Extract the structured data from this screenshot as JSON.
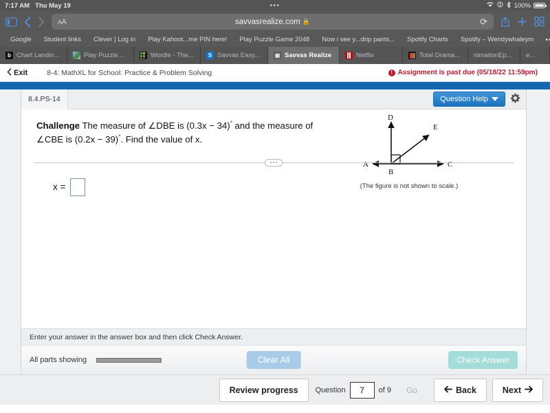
{
  "status_bar": {
    "time": "7:17 AM",
    "date": "Thu May 19",
    "center_dots": "•••",
    "wifi_icon": "wifi-icon",
    "location_icon": "location-icon",
    "bluetooth_icon": "bluetooth-icon",
    "battery_percent": "100%"
  },
  "browser": {
    "sidebar_icon": "sidebar-icon",
    "back_icon": "chevron-left-icon",
    "forward_icon": "chevron-right-icon",
    "text_size_label": "AA",
    "url": "savvasrealize.com",
    "lock_icon": "lock-icon",
    "reload_icon": "reload-icon",
    "share_icon": "share-icon",
    "new_tab_icon": "plus-icon",
    "tabs_overview_icon": "tabs-grid-icon",
    "bookmarks": [
      "Google",
      "Student links",
      "Clever | Log in",
      "Play Kahoot...me PIN here!",
      "Play Puzzle Game 2048",
      "Now i see y...drip pants...",
      "Spotify Charts",
      "Spotify – Wendywhaleym"
    ],
    "bookmarks_more": "•••",
    "tabs": [
      {
        "title": "Chart Landin...",
        "favicon": "b-logo-icon",
        "active": false
      },
      {
        "title": "Play Puzzle...",
        "favicon": "puzzle-icon",
        "active": false
      },
      {
        "title": "Wordle - The...",
        "favicon": "wordle-grid-icon",
        "active": false
      },
      {
        "title": "Savvas Easy...",
        "favicon": "savvas-s-icon",
        "active": false
      },
      {
        "title": "Savvas Realize",
        "favicon": "savvas-realize-icon",
        "active": true
      },
      {
        "title": "Netflix",
        "favicon": "netflix-icon",
        "active": false
      },
      {
        "title": "Total Drama...",
        "favicon": "total-drama-icon",
        "active": false
      },
      {
        "title": "nimationEp...",
        "favicon": "none",
        "active": false
      },
      {
        "title": "e...",
        "favicon": "none",
        "active": false
      }
    ]
  },
  "app_header": {
    "exit_label": "Exit",
    "exit_icon": "chevron-left-icon",
    "assignment_title": "8-4: MathXL for School: Practice & Problem Solving",
    "past_due_icon": "alert-icon",
    "past_due_text": "Assignment is past due (05/18/22 11:59pm)"
  },
  "exercise": {
    "question_id": "8.4.PS-14",
    "question_help_label": "Question Help",
    "question_help_caret": "chevron-down-icon",
    "settings_icon": "gear-icon",
    "prompt_bold": "Challenge",
    "prompt_line1_a": "  The measure of ∠DBE is (0.3x − 34)",
    "prompt_line1_b": " and the",
    "prompt_line2_a": "measure of ∠CBE is (0.2x − 39)",
    "prompt_line2_b": ". Find the value of x.",
    "degree_symbol": "°",
    "figure": {
      "label_a": "A",
      "label_b": "B",
      "label_c": "C",
      "label_d": "D",
      "label_e": "E",
      "caption": "(The figure is not shown to scale.)"
    },
    "answer_label": "x =",
    "answer_value": "",
    "splitter_handle": "drag-handle-icon"
  },
  "footer": {
    "instruction": "Enter your answer in the answer box and then click Check Answer.",
    "parts_label": "All parts showing",
    "clear_all_label": "Clear All",
    "check_answer_label": "Check Answer"
  },
  "bottom_nav": {
    "review_progress_label": "Review progress",
    "question_label": "Question",
    "question_number": "7",
    "of_label": "of 9",
    "go_label": "Go",
    "back_label": "Back",
    "back_icon": "arrow-left-icon",
    "next_label": "Next",
    "next_icon": "arrow-right-icon"
  },
  "colors": {
    "accent_blue": "#1267ae",
    "alert_red": "#c0192e",
    "check_teal": "#a3dcd9",
    "clear_blue": "#a8cce8"
  }
}
